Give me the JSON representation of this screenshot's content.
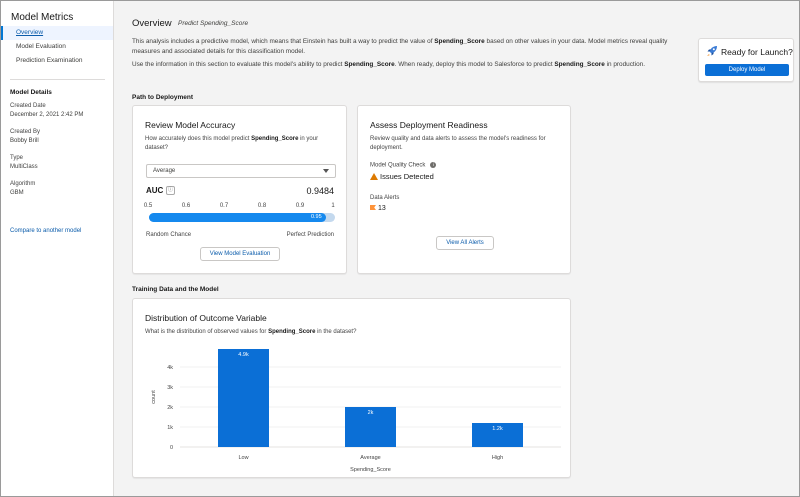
{
  "sidebar": {
    "title": "Model Metrics",
    "nav": [
      {
        "label": "Overview",
        "active": true
      },
      {
        "label": "Model Evaluation",
        "active": false
      },
      {
        "label": "Prediction Examination",
        "active": false
      }
    ],
    "details_header": "Model Details",
    "details": [
      {
        "label": "Created Date",
        "value": "December 2, 2021 2:42 PM"
      },
      {
        "label": "Created By",
        "value": "Bobby Brill"
      },
      {
        "label": "Type",
        "value": "MultiClass"
      },
      {
        "label": "Algorithm",
        "value": "GBM"
      }
    ],
    "compare_link": "Compare to another model"
  },
  "header": {
    "title": "Overview",
    "subtitle": "Predict Spending_Score",
    "intro1_a": "This analysis includes a predictive model, which means that Einstein has built a way to predict the value of ",
    "intro1_b": "Spending_Score",
    "intro1_c": " based on other values in your data. Model metrics reveal quality measures and associated details for this classification model.",
    "intro2_a": "Use the information in this section to evaluate this model's ability to predict ",
    "intro2_b": "Spending_Score",
    "intro2_c": ". When ready, deploy this model to Salesforce to predict ",
    "intro2_d": "Spending_Score",
    "intro2_e": " in production."
  },
  "launch": {
    "title": "Ready for Launch?",
    "button": "Deploy Model",
    "icon": "rocket-icon"
  },
  "path_section": "Path to Deployment",
  "accuracy_card": {
    "title": "Review Model Accuracy",
    "desc_a": "How accurately does this model predict ",
    "desc_b": "Spending_Score",
    "desc_c": " in your dataset?",
    "select_value": "Average",
    "auc_label": "AUC",
    "auc_value": "0.9484",
    "scale": [
      "0.5",
      "0.6",
      "0.7",
      "0.8",
      "0.9",
      "1"
    ],
    "bar_label": "0.95",
    "bar_fraction": 0.95,
    "left_label": "Random Chance",
    "right_label": "Perfect Prediction",
    "button": "View Model Evaluation"
  },
  "readiness_card": {
    "title": "Assess Deployment Readiness",
    "desc": "Review quality and data alerts to assess the model's readiness for deployment.",
    "quality_label": "Model Quality Check",
    "quality_status": "Issues Detected",
    "alerts_label": "Data Alerts",
    "alerts_count": "13",
    "button": "View All Alerts"
  },
  "training_section": "Training Data and the Model",
  "distribution_card": {
    "title": "Distribution of Outcome Variable",
    "desc_a": "What is the distribution of observed values for ",
    "desc_b": "Spending_Score",
    "desc_c": " in the dataset?"
  },
  "chart_data": {
    "type": "bar",
    "categories": [
      "Low",
      "Average",
      "High"
    ],
    "values": [
      4900,
      2000,
      1200
    ],
    "data_labels": [
      "4.9k",
      "2k",
      "1.2k"
    ],
    "xlabel": "Spending_Score",
    "ylabel": "count",
    "yticks": [
      "0",
      "1k",
      "2k",
      "3k",
      "4k"
    ],
    "ylim": [
      0,
      5000
    ],
    "grid": true,
    "bar_color": "#0b6fd6"
  }
}
